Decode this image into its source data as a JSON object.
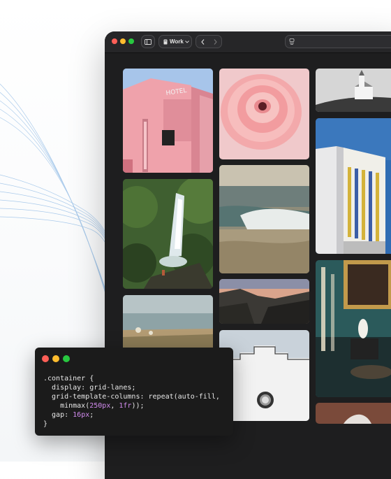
{
  "browser": {
    "tab_group_label": "Work",
    "colors": {
      "close": "#ff5f57",
      "minimize": "#febc2e",
      "zoom": "#28c840"
    }
  },
  "code": {
    "lines": [
      ".container {",
      "  display: grid-lanes;",
      "  grid-template-columns: repeat(auto-fill,",
      "    minmax(250px, 1fr));",
      "  gap: 16px;",
      "}"
    ]
  },
  "gallery": {
    "tiles": [
      {
        "name": "photo-pink-hotel",
        "alt": "pink hotel building"
      },
      {
        "name": "photo-pink-flower",
        "alt": "pink ranunculus flower"
      },
      {
        "name": "photo-white-church",
        "alt": "white church on hill"
      },
      {
        "name": "photo-waterfall",
        "alt": "waterfall in jungle"
      },
      {
        "name": "photo-ocean-wave",
        "alt": "ocean wave"
      },
      {
        "name": "photo-white-building",
        "alt": "white building with yellow windows"
      },
      {
        "name": "photo-mountains-dusk",
        "alt": "mountains at dusk"
      },
      {
        "name": "photo-sea-grass",
        "alt": "sea with grass"
      },
      {
        "name": "photo-white-wall",
        "alt": "white wall with round window"
      },
      {
        "name": "photo-ornate-room",
        "alt": "ornate teal room with candles"
      }
    ]
  }
}
